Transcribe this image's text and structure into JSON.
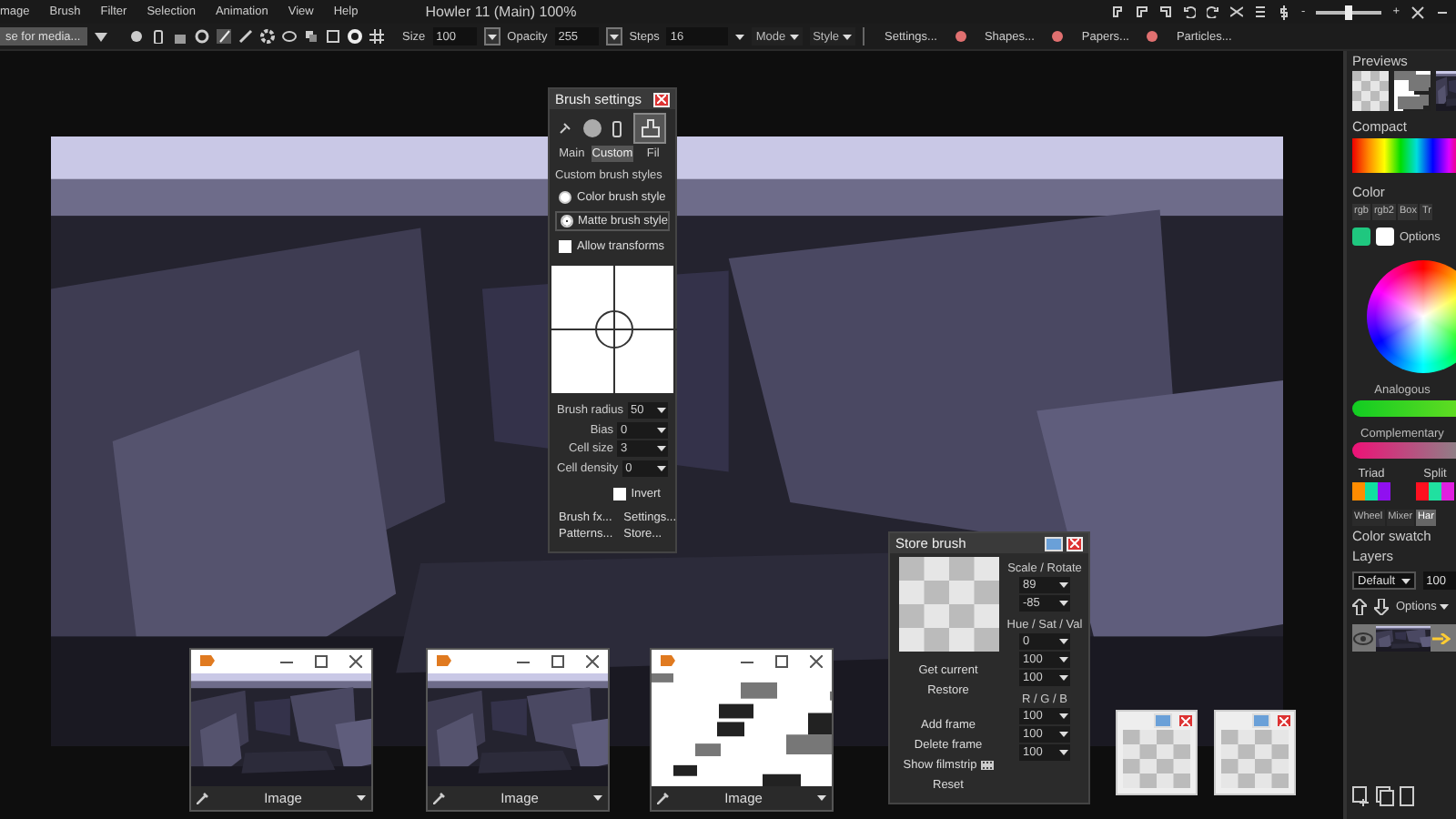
{
  "menu": [
    "mage",
    "Brush",
    "Filter",
    "Selection",
    "Animation",
    "View",
    "Help"
  ],
  "title": "Howler 11  (Main)  100%",
  "toolbar": {
    "preset": "se for media...",
    "size_label": "Size",
    "size": "100",
    "opacity_label": "Opacity",
    "opacity": "255",
    "steps_label": "Steps",
    "steps": "16",
    "mode": "Mode",
    "style": "Style",
    "links": [
      "Settings...",
      "Shapes...",
      "Papers...",
      "Particles..."
    ]
  },
  "zoom_slider": {
    "minus": "-",
    "plus": "+",
    "level": 0.5
  },
  "brush_settings": {
    "title": "Brush settings",
    "tabs": [
      {
        "label": "Main",
        "selected": false
      },
      {
        "label": "Custom",
        "selected": true
      },
      {
        "label": "Fil",
        "selected": false
      }
    ],
    "section": "Custom brush styles",
    "styles": [
      {
        "label": "Color brush style",
        "selected": false
      },
      {
        "label": "Matte brush style",
        "selected": true
      }
    ],
    "allow_transforms": {
      "label": "Allow transforms",
      "checked": false
    },
    "fields": [
      {
        "label": "Brush radius",
        "value": "50"
      },
      {
        "label": "Bias",
        "value": "0"
      },
      {
        "label": "Cell size",
        "value": "3"
      },
      {
        "label": "Cell density",
        "value": "0"
      }
    ],
    "invert": {
      "label": "Invert",
      "checked": false
    },
    "links": [
      "Brush fx...",
      "Settings...",
      "Patterns...",
      "Store..."
    ]
  },
  "store_brush": {
    "title": "Store brush",
    "scale_rotate_label": "Scale / Rotate",
    "scale_rotate": [
      "89",
      "-85"
    ],
    "hsv_label": "Hue / Sat / Val",
    "hsv": [
      "0",
      "100",
      "100"
    ],
    "rgb_label": "R / G / B",
    "rgb": [
      "100",
      "100",
      "100"
    ],
    "actions": [
      "Get current",
      "Restore",
      "Add frame",
      "Delete frame",
      "Show filmstrip",
      "Reset"
    ]
  },
  "image_windows": [
    {
      "label": "Image"
    },
    {
      "label": "Image"
    },
    {
      "label": "Image"
    }
  ],
  "right_panel": {
    "previews_title": "Previews",
    "compact_title": "Compact",
    "color_title": "Color",
    "color_tabs": [
      {
        "label": "rgb",
        "selected": false
      },
      {
        "label": "rgb2",
        "selected": false
      },
      {
        "label": "Box",
        "selected": false
      },
      {
        "label": "Tr",
        "selected": false
      }
    ],
    "swatches": [
      {
        "color": "#1fc77f"
      },
      {
        "color": "#ffffff"
      }
    ],
    "options": "Options",
    "analogous": "Analogous",
    "complementary": "Complementary",
    "triad": {
      "label": "Triad",
      "colors": [
        {
          "color": "#ff8c00"
        },
        {
          "color": "#10e0a0"
        },
        {
          "color": "#9010f0"
        }
      ]
    },
    "split": {
      "label": "Split",
      "colors": [
        {
          "color": "#ff1020"
        },
        {
          "color": "#20e0a0"
        },
        {
          "color": "#e020e0"
        }
      ]
    },
    "mode_tabs": [
      {
        "label": "Wheel",
        "selected": false
      },
      {
        "label": "Mixer",
        "selected": false
      },
      {
        "label": "Har",
        "selected": true
      }
    ],
    "swatch_title": "Color swatch",
    "layers_title": "Layers",
    "blend": "Default",
    "layer_opacity": "100",
    "layer_options": "Options"
  }
}
